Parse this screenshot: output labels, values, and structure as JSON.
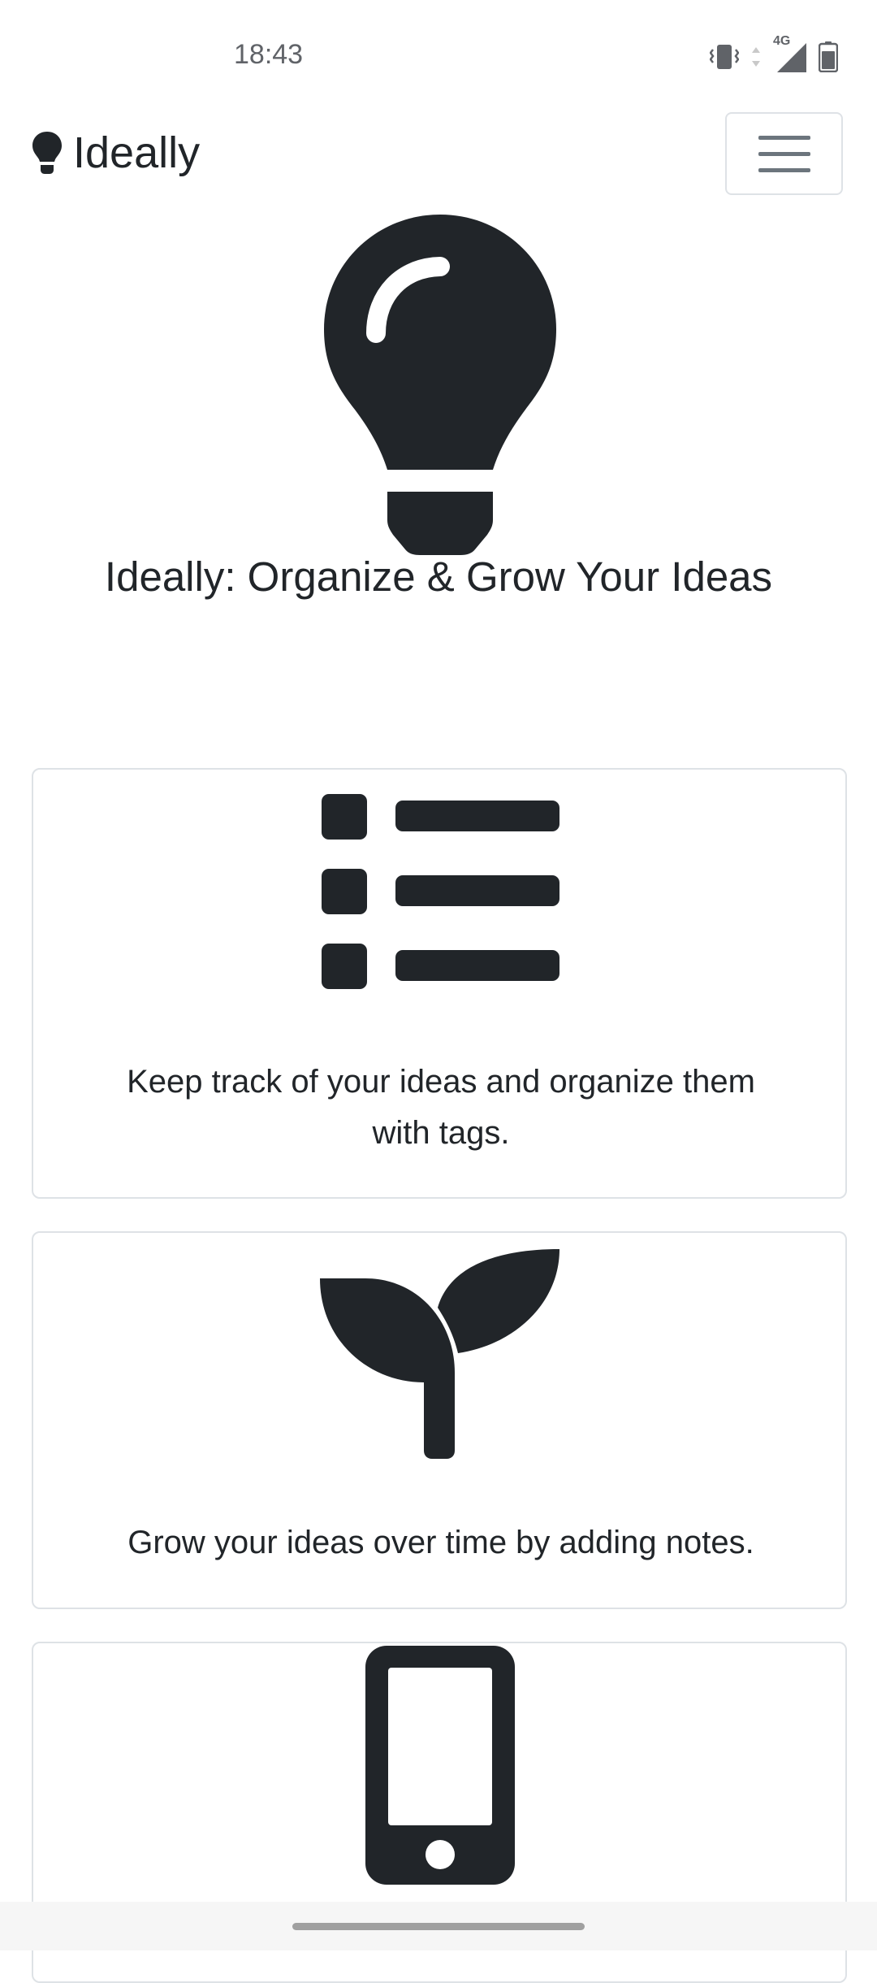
{
  "status_bar": {
    "time": "18:43",
    "network_label": "4G",
    "icons": [
      "vibrate-icon",
      "data-arrows-icon",
      "signal-icon",
      "battery-icon"
    ]
  },
  "navbar": {
    "brand": "Ideally",
    "brand_icon": "lightbulb-icon",
    "menu_icon": "hamburger-menu-icon"
  },
  "hero": {
    "icon": "lightbulb-icon",
    "title": "Ideally: Organize & Grow Your Ideas"
  },
  "features": [
    {
      "icon": "list-icon",
      "text": "Keep track of your ideas and organize them with tags."
    },
    {
      "icon": "sprout-icon",
      "text": "Grow your ideas over time by adding notes."
    },
    {
      "icon": "phone-icon",
      "text": ""
    }
  ],
  "colors": {
    "text": "#212529",
    "border": "#dee2e6",
    "background": "#ffffff",
    "status_text": "#606368"
  }
}
